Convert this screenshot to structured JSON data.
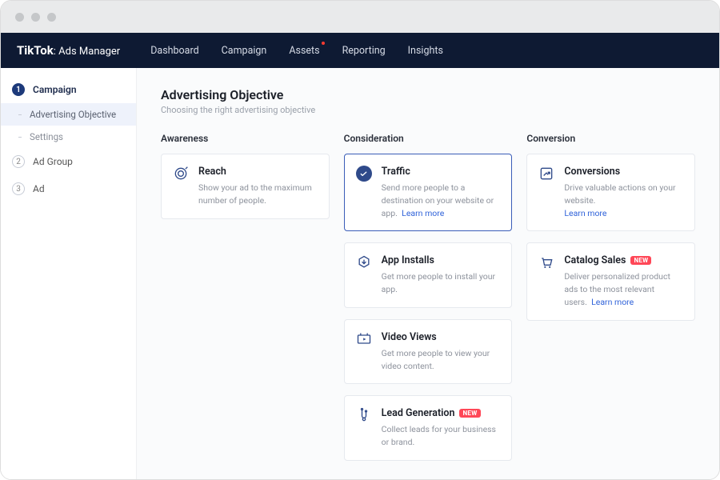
{
  "brand": {
    "name": "TikTok",
    "suffix": ": Ads Manager"
  },
  "nav": {
    "items": [
      {
        "label": "Dashboard"
      },
      {
        "label": "Campaign"
      },
      {
        "label": "Assets",
        "dot": true
      },
      {
        "label": "Reporting"
      },
      {
        "label": "Insights"
      }
    ]
  },
  "sidebar": {
    "steps": [
      {
        "num": "1",
        "label": "Campaign",
        "active": true,
        "subs": [
          {
            "label": "Advertising Objective",
            "selected": true
          },
          {
            "label": "Settings"
          }
        ]
      },
      {
        "num": "2",
        "label": "Ad Group"
      },
      {
        "num": "3",
        "label": "Ad"
      }
    ]
  },
  "page": {
    "title": "Advertising Objective",
    "subtitle": "Choosing the right advertising objective",
    "learn_more": "Learn more",
    "new_badge": "NEW"
  },
  "columns": {
    "awareness": {
      "heading": "Awareness",
      "cards": [
        {
          "title": "Reach",
          "desc": "Show your ad to the maximum number of people."
        }
      ]
    },
    "consideration": {
      "heading": "Consideration",
      "cards": [
        {
          "title": "Traffic",
          "desc": "Send more people to a destination on your website or app.",
          "selected": true,
          "learn": true
        },
        {
          "title": "App Installs",
          "desc": "Get more people to install your app."
        },
        {
          "title": "Video Views",
          "desc": "Get more people to view your video content."
        },
        {
          "title": "Lead Generation",
          "desc": "Collect leads for your business or brand.",
          "new": true
        }
      ]
    },
    "conversion": {
      "heading": "Conversion",
      "cards": [
        {
          "title": "Conversions",
          "desc": "Drive valuable actions on your website.",
          "learn": true
        },
        {
          "title": "Catalog Sales",
          "desc": "Deliver personalized product ads to the most relevant users.",
          "new": true,
          "learn": true
        }
      ]
    }
  }
}
